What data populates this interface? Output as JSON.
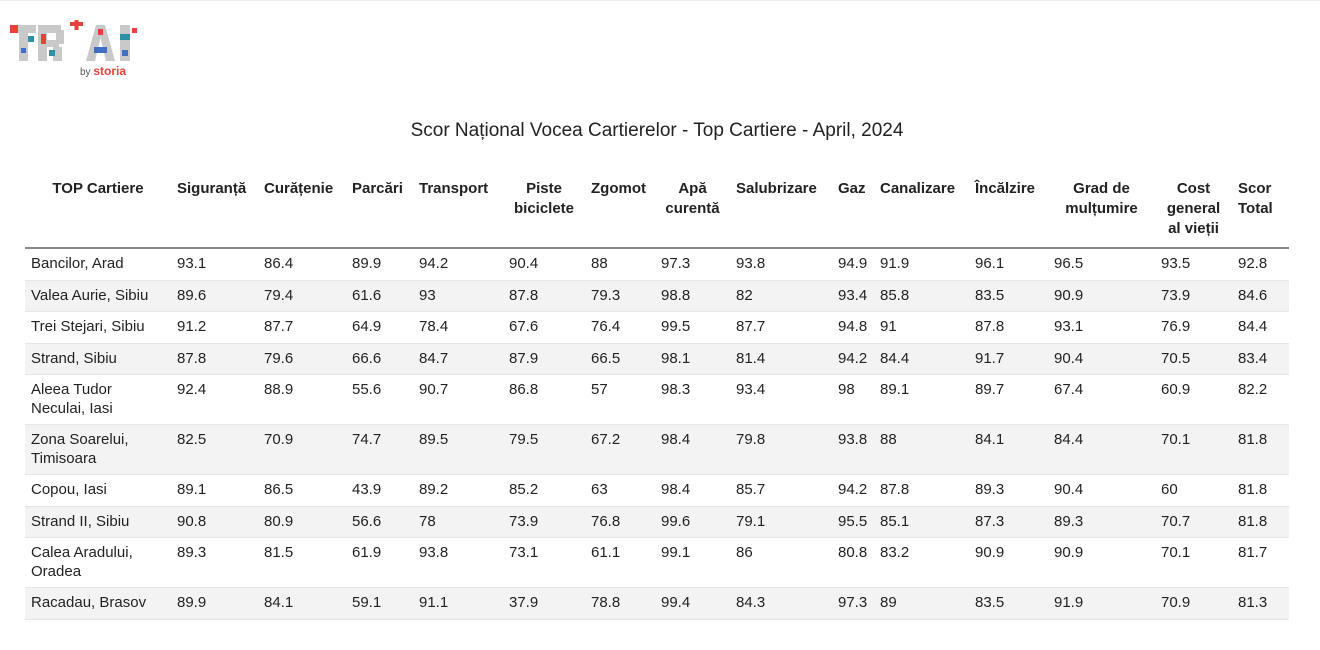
{
  "logo": {
    "by_text": "by",
    "brand_text": "storia",
    "colors": {
      "red": "#e8403a",
      "teal": "#2f8fa3",
      "blue": "#3f6fc4",
      "grey": "#c9c9c9"
    }
  },
  "title": "Scor Național Vocea Cartierelor - Top Cartiere - April, 2024",
  "table": {
    "headers": [
      "TOP Cartiere",
      "Siguranță",
      "Curățenie",
      "Parcări",
      "Transport",
      "Piste biciclete",
      "Zgomot",
      "Apă curentă",
      "Salubrizare",
      "Gaz",
      "Canalizare",
      "Încălzire",
      "Grad de mulțumire",
      "Cost general al vieții",
      "Scor Total"
    ],
    "rows": [
      [
        "Bancilor, Arad",
        "93.1",
        "86.4",
        "89.9",
        "94.2",
        "90.4",
        "88",
        "97.3",
        "93.8",
        "94.9",
        "91.9",
        "96.1",
        "96.5",
        "93.5",
        "92.8"
      ],
      [
        "Valea Aurie, Sibiu",
        "89.6",
        "79.4",
        "61.6",
        "93",
        "87.8",
        "79.3",
        "98.8",
        "82",
        "93.4",
        "85.8",
        "83.5",
        "90.9",
        "73.9",
        "84.6"
      ],
      [
        "Trei Stejari, Sibiu",
        "91.2",
        "87.7",
        "64.9",
        "78.4",
        "67.6",
        "76.4",
        "99.5",
        "87.7",
        "94.8",
        "91",
        "87.8",
        "93.1",
        "76.9",
        "84.4"
      ],
      [
        "Strand, Sibiu",
        "87.8",
        "79.6",
        "66.6",
        "84.7",
        "87.9",
        "66.5",
        "98.1",
        "81.4",
        "94.2",
        "84.4",
        "91.7",
        "90.4",
        "70.5",
        "83.4"
      ],
      [
        "Aleea Tudor Neculai, Iasi",
        "92.4",
        "88.9",
        "55.6",
        "90.7",
        "86.8",
        "57",
        "98.3",
        "93.4",
        "98",
        "89.1",
        "89.7",
        "67.4",
        "60.9",
        "82.2"
      ],
      [
        "Zona Soarelui, Timisoara",
        "82.5",
        "70.9",
        "74.7",
        "89.5",
        "79.5",
        "67.2",
        "98.4",
        "79.8",
        "93.8",
        "88",
        "84.1",
        "84.4",
        "70.1",
        "81.8"
      ],
      [
        "Copou, Iasi",
        "89.1",
        "86.5",
        "43.9",
        "89.2",
        "85.2",
        "63",
        "98.4",
        "85.7",
        "94.2",
        "87.8",
        "89.3",
        "90.4",
        "60",
        "81.8"
      ],
      [
        "Strand II, Sibiu",
        "90.8",
        "80.9",
        "56.6",
        "78",
        "73.9",
        "76.8",
        "99.6",
        "79.1",
        "95.5",
        "85.1",
        "87.3",
        "89.3",
        "70.7",
        "81.8"
      ],
      [
        "Calea Aradului, Oradea",
        "89.3",
        "81.5",
        "61.9",
        "93.8",
        "73.1",
        "61.1",
        "99.1",
        "86",
        "80.8",
        "83.2",
        "90.9",
        "90.9",
        "70.1",
        "81.7"
      ],
      [
        "Racadau, Brasov",
        "89.9",
        "84.1",
        "59.1",
        "91.1",
        "37.9",
        "78.8",
        "99.4",
        "84.3",
        "97.3",
        "89",
        "83.5",
        "91.9",
        "70.9",
        "81.3"
      ]
    ]
  }
}
